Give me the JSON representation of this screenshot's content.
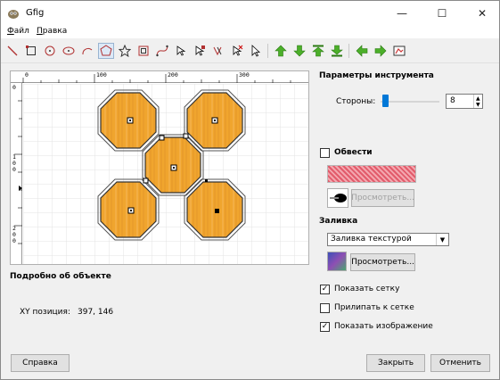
{
  "window": {
    "title": "Gfig",
    "minimize_glyph": "—",
    "maximize_glyph": "☐",
    "close_glyph": "✕"
  },
  "menu": [
    {
      "label": "Файл",
      "accel": "Ф",
      "rest": "айл"
    },
    {
      "label": "Правка",
      "accel": "П",
      "rest": "равка"
    }
  ],
  "toolbar_icons": [
    "line-icon",
    "rectangle-icon",
    "circle-icon",
    "ellipse-icon",
    "arc-icon",
    "polygon-icon",
    "star-icon",
    "spiral-icon",
    "bezier-icon",
    "move-object-icon",
    "move-point-icon",
    "copy-object-icon",
    "delete-object-icon",
    "select-object-icon",
    "raise-icon",
    "lower-icon",
    "raise-to-top-icon",
    "lower-to-bottom-icon",
    "prev-object-icon",
    "next-object-icon",
    "show-all-icon"
  ],
  "rulers": {
    "top": [
      "0",
      "100",
      "200",
      "300"
    ],
    "left": [
      "0",
      "100",
      "200"
    ]
  },
  "tool_options": {
    "title": "Параметры инструмента",
    "sides_label": "Стороны:",
    "sides_value": "8",
    "sides_fraction": 0.03
  },
  "stroke": {
    "label": "Обвести",
    "checked": false,
    "preview_button": "Просмотреть..."
  },
  "fill": {
    "title": "Заливка",
    "type": "Заливка текстурой",
    "preview_button": "Просмотреть..."
  },
  "options": {
    "show_grid": {
      "label": "Показать сетку",
      "checked": true
    },
    "snap_to_grid": {
      "label": "Прилипать к сетке",
      "checked": false
    },
    "show_image": {
      "label": "Показать изображение",
      "checked": true
    }
  },
  "object_details": {
    "title": "Подробно об объекте",
    "position_label": "XY позиция:",
    "position_value": "397, 146"
  },
  "buttons": {
    "help": "Справка",
    "close": "Закрыть",
    "cancel": "Отменить"
  },
  "colors": {
    "stroke_pattern": "#e25b6b",
    "fill_wood": "#f0a52e",
    "selected": "#99b4d1"
  }
}
